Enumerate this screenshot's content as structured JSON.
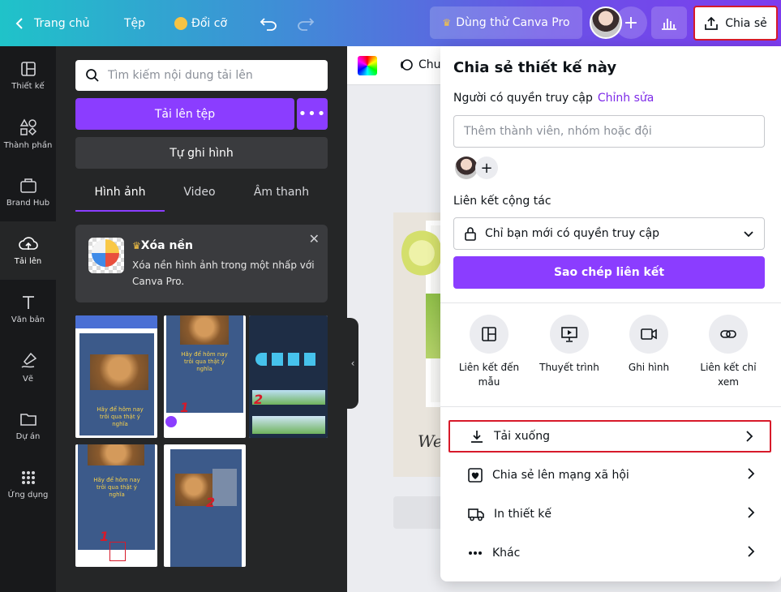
{
  "topbar": {
    "home": "Trang chủ",
    "file": "Tệp",
    "resize": "Đổi cỡ",
    "try_pro": "Dùng thử Canva Pro",
    "share": "Chia sẻ"
  },
  "rail": {
    "items": [
      {
        "label": "Thiết kế",
        "icon": "layout-icon"
      },
      {
        "label": "Thành phần",
        "icon": "shapes-icon"
      },
      {
        "label": "Brand Hub",
        "icon": "brand-hub-icon"
      },
      {
        "label": "Tải lên",
        "icon": "upload-cloud-icon"
      },
      {
        "label": "Văn bản",
        "icon": "text-icon"
      },
      {
        "label": "Vẽ",
        "icon": "draw-icon"
      },
      {
        "label": "Dự án",
        "icon": "folder-icon"
      },
      {
        "label": "Ứng dụng",
        "icon": "apps-grid-icon"
      }
    ]
  },
  "panel": {
    "search_placeholder": "Tìm kiếm nội dung tải lên",
    "upload_files": "Tải lên tệp",
    "more": "•••",
    "record": "Tự ghi hình",
    "tabs": [
      "Hình ảnh",
      "Video",
      "Âm thanh"
    ],
    "promo": {
      "title": "Xóa nền",
      "text": "Xóa nền hình ảnh trong một nhấp với Canva Pro."
    },
    "thumb_text": "Hãy để hôm nay trôi qua thật ý nghĩa",
    "thumb_numbers": [
      "1",
      "2",
      "1",
      "2"
    ]
  },
  "toolbar": {
    "partial_label": "Chu"
  },
  "share_panel": {
    "title": "Chia sẻ thiết kế này",
    "access_label": "Người có quyền truy cập",
    "edit": "Chỉnh sửa",
    "member_placeholder": "Thêm thành viên, nhóm hoặc đội",
    "collab_link_label": "Liên kết cộng tác",
    "link_access": "Chỉ bạn mới có quyền truy cập",
    "copy_link": "Sao chép liên kết",
    "options": [
      {
        "label": "Liên kết đến mẫu",
        "icon": "template-icon"
      },
      {
        "label": "Thuyết trình",
        "icon": "present-icon"
      },
      {
        "label": "Ghi hình",
        "icon": "video-camera-icon"
      },
      {
        "label": "Liên kết chỉ xem",
        "icon": "link-icon"
      }
    ],
    "rows": [
      {
        "label": "Tải xuống",
        "icon": "download-icon"
      },
      {
        "label": "Chia sẻ lên mạng xã hội",
        "icon": "heart-icon"
      },
      {
        "label": "In thiết kế",
        "icon": "truck-icon"
      },
      {
        "label": "Khác",
        "icon": "more-dots-icon"
      }
    ]
  },
  "colors": {
    "accent": "#8b3dff",
    "highlight": "#d71a2a",
    "rail_bg": "#18191b",
    "panel_bg": "#252627"
  }
}
